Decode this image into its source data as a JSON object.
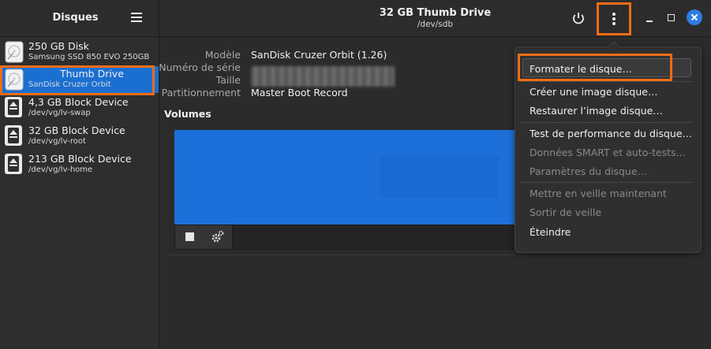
{
  "sidebar": {
    "title": "Disques",
    "items": [
      {
        "name": "250 GB Disk",
        "sub": "Samsung SSD 850 EVO 250GB",
        "icon": "hard-disk-icon"
      },
      {
        "name": "Thumb Drive",
        "sub": "SanDisk Cruzer Orbit",
        "icon": "hard-disk-icon"
      },
      {
        "name": "4,3 GB Block Device",
        "sub": "/dev/vg/lv-swap",
        "icon": "eject-icon"
      },
      {
        "name": "32 GB Block Device",
        "sub": "/dev/vg/lv-root",
        "icon": "eject-icon"
      },
      {
        "name": "213 GB Block Device",
        "sub": "/dev/vg/lv-home",
        "icon": "eject-icon"
      }
    ]
  },
  "header": {
    "title": "32 GB Thumb Drive",
    "subtitle": "/dev/sdb"
  },
  "details": {
    "model_label": "Modèle",
    "model_value": "SanDisk Cruzer Orbit (1.26)",
    "serial_label": "Numéro de série",
    "size_label": "Taille",
    "partitioning_label": "Partitionnement",
    "partitioning_value": "Master Boot Record"
  },
  "volumes": {
    "title": "Volumes"
  },
  "menu": {
    "items": [
      {
        "label": "Formater le disque…",
        "enabled": true
      },
      {
        "label": "Créer une image disque…",
        "enabled": true
      },
      {
        "label": "Restaurer l’image disque…",
        "enabled": true
      },
      {
        "label": "Test de performance du disque…",
        "enabled": true
      },
      {
        "label": "Données SMART et auto-tests…",
        "enabled": false
      },
      {
        "label": "Paramètres du disque…",
        "enabled": false
      },
      {
        "label": "Mettre en veille maintenant",
        "enabled": false
      },
      {
        "label": "Sortir de veille",
        "enabled": false
      },
      {
        "label": "Éteindre",
        "enabled": true
      }
    ]
  },
  "colors": {
    "accent": "#1b6fd1",
    "highlight": "#f06c16",
    "volume": "#1d6fda"
  }
}
